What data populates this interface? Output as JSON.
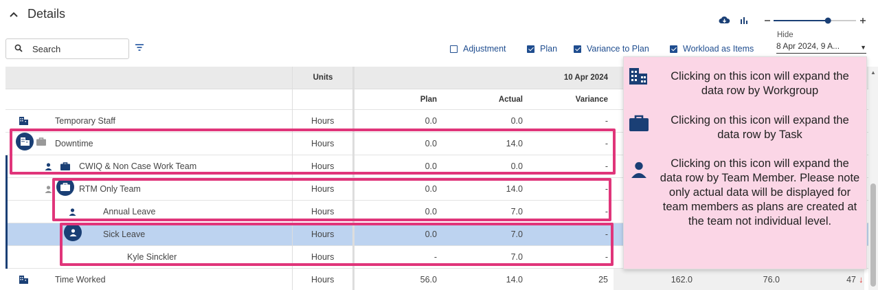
{
  "header": {
    "title": "Details",
    "collapse_icon": "chevron-up-icon"
  },
  "search": {
    "placeholder": "Search"
  },
  "checkboxes": [
    {
      "label": "Adjustment",
      "checked": false
    },
    {
      "label": "Plan",
      "checked": true
    },
    {
      "label": "Variance to Plan",
      "checked": true
    },
    {
      "label": "Workload as Items",
      "checked": true
    }
  ],
  "zoom": {
    "level": 0.66,
    "minus": "−",
    "plus": "+"
  },
  "hide": {
    "label": "Hide",
    "value": "8 Apr 2024, 9 A..."
  },
  "table": {
    "units_header": "Units",
    "date_header": "10 Apr 2024",
    "col_plan": "Plan",
    "col_actual": "Actual",
    "col_variance": "Variance",
    "rows": [
      {
        "name": "Temporary Staff",
        "units": "Hours",
        "plan": "0.0",
        "actual": "0.0",
        "variance": "-"
      },
      {
        "name": "Downtime",
        "units": "Hours",
        "plan": "0.0",
        "actual": "14.0",
        "variance": "-"
      },
      {
        "name": "CWIQ & Non Case Work Team",
        "units": "Hours",
        "plan": "0.0",
        "actual": "0.0",
        "variance": "-"
      },
      {
        "name": "RTM Only Team",
        "units": "Hours",
        "plan": "0.0",
        "actual": "14.0",
        "variance": "-"
      },
      {
        "name": "Annual Leave",
        "units": "Hours",
        "plan": "0.0",
        "actual": "7.0",
        "variance": "-"
      },
      {
        "name": "Sick Leave",
        "units": "Hours",
        "plan": "0.0",
        "actual": "7.0",
        "variance": "-"
      },
      {
        "name": "Kyle Sinckler",
        "units": "Hours",
        "plan": "-",
        "actual": "7.0",
        "variance": "-"
      },
      {
        "name": "Time Worked",
        "units": "Hours",
        "plan": "56.0",
        "actual": "14.0",
        "variance": "25",
        "plan2": "162.0",
        "actual2": "76.0",
        "variance2": "47"
      }
    ]
  },
  "tooltip": {
    "workgroup": "Clicking on this icon will expand the data row by Workgroup",
    "task": "Clicking on this icon will expand the data row by Task",
    "member": "Clicking on this icon will expand the data row by Team Member. Please note only actual data will be displayed for team members as plans are created at the team not individual level."
  },
  "colors": {
    "accent": "#1a3f75",
    "highlight": "#e0357a",
    "tooltip_bg": "#fbd6e6",
    "selected_row": "#bdd3f0"
  }
}
